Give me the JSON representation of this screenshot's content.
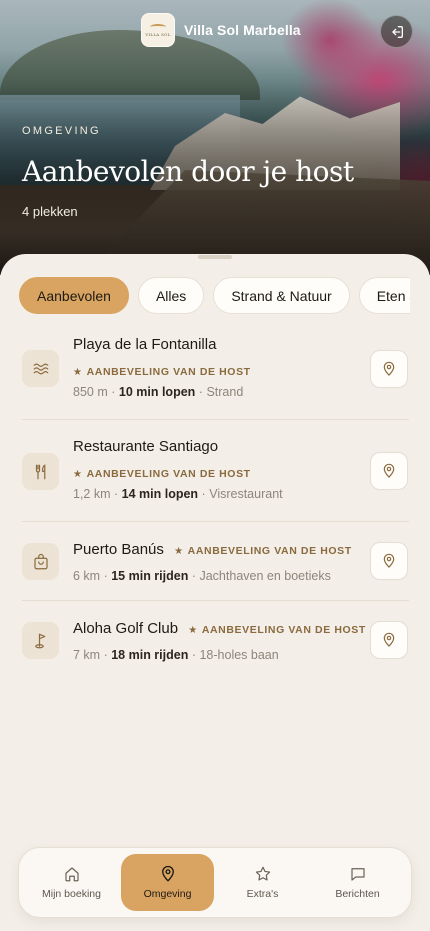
{
  "header": {
    "brand_name": "Villa Sol Marbella",
    "logo_text": "VILLA SOL",
    "logout_icon": "logout-icon"
  },
  "hero": {
    "eyebrow": "OMGEVING",
    "title": "Aanbevolen door je host",
    "count": "4 plekken"
  },
  "filters": {
    "chips": [
      {
        "label": "Aanbevolen",
        "active": true
      },
      {
        "label": "Alles",
        "active": false
      },
      {
        "label": "Strand & Natuur",
        "active": false
      },
      {
        "label": "Eten & Drinken",
        "active": false
      }
    ]
  },
  "places": [
    {
      "name": "Playa de la Fontanilla",
      "tag": "AANBEVELING VAN DE HOST",
      "distance": "850 m",
      "travel": "10 min lopen",
      "category": "Strand",
      "icon": "waves-icon"
    },
    {
      "name": "Restaurante Santiago",
      "tag": "AANBEVELING VAN DE HOST",
      "distance": "1,2 km",
      "travel": "14 min lopen",
      "category": "Visrestaurant",
      "icon": "cutlery-icon"
    },
    {
      "name": "Puerto Banús",
      "tag": "AANBEVELING VAN DE HOST",
      "distance": "6 km",
      "travel": "15 min rijden",
      "category": "Jachthaven en boetieks",
      "icon": "shopping-bag-icon"
    },
    {
      "name": "Aloha Golf Club",
      "tag": "AANBEVELING VAN DE HOST",
      "distance": "7 km",
      "travel": "18 min rijden",
      "category": "18-holes baan",
      "icon": "golf-flag-icon"
    }
  ],
  "separator": "·",
  "tag_star": "★",
  "nav": {
    "items": [
      {
        "label": "Mijn boeking",
        "icon": "home-icon",
        "active": false
      },
      {
        "label": "Omgeving",
        "icon": "map-pin-icon",
        "active": true
      },
      {
        "label": "Extra's",
        "icon": "star-icon",
        "active": false
      },
      {
        "label": "Berichten",
        "icon": "message-icon",
        "active": false
      }
    ]
  },
  "colors": {
    "accent": "#d9a461",
    "background": "#f3efe8",
    "tag_text": "#8a6a3e"
  }
}
